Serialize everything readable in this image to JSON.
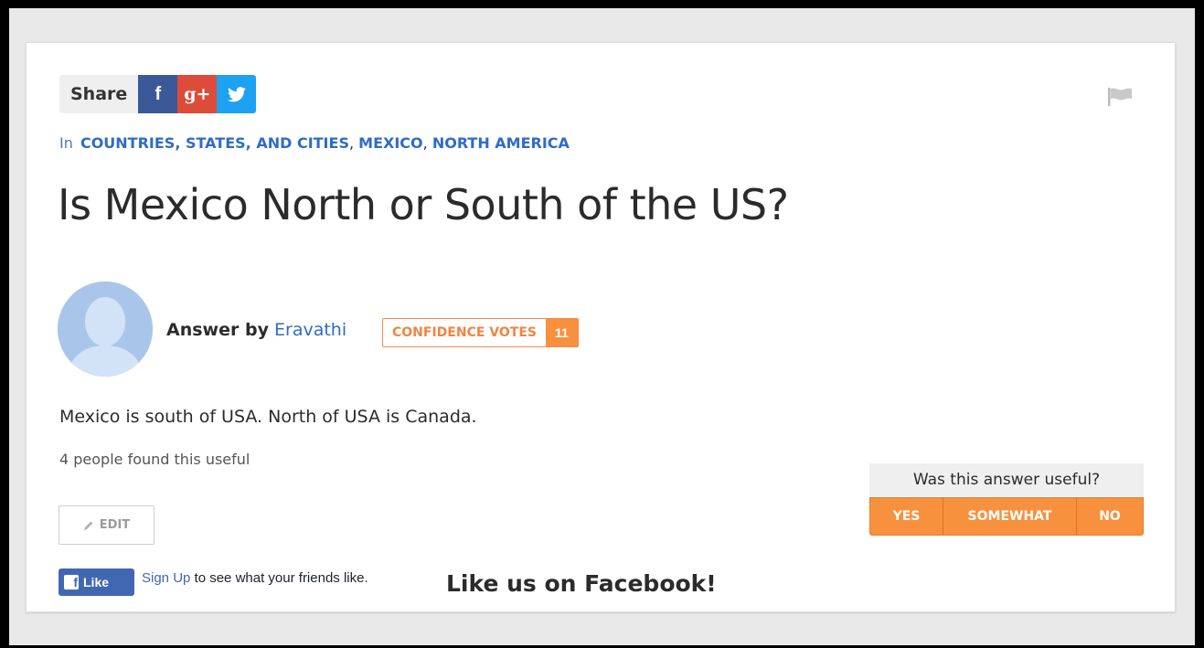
{
  "share": {
    "label": "Share",
    "facebook_glyph": "f",
    "googleplus_glyph": "g+",
    "twitter_icon": "twitter-bird-icon"
  },
  "breadcrumb": {
    "prefix": "In",
    "items": [
      "COUNTRIES, STATES, AND CITIES",
      "MEXICO",
      "NORTH AMERICA"
    ],
    "separator": ","
  },
  "question": {
    "title": "Is Mexico North or South of the US?"
  },
  "answer": {
    "by_label": "Answer by",
    "author": "Eravathi",
    "confidence_label": "CONFIDENCE VOTES",
    "confidence_count": "11",
    "text": "Mexico is south of USA. North of USA is Canada.",
    "useful_count_text": "4 people found this useful",
    "edit_label": "EDIT"
  },
  "feedback": {
    "question": "Was this answer useful?",
    "yes": "YES",
    "somewhat": "SOMEWHAT",
    "no": "NO"
  },
  "facebook": {
    "like_label": "Like",
    "signup_link": "Sign Up",
    "signup_text": " to see what your friends like.",
    "promo": "Like us on Facebook!"
  },
  "colors": {
    "accent_orange": "#f7913d",
    "link_blue": "#2e6cc7",
    "facebook_blue": "#3b5998",
    "googleplus_red": "#dd4b39",
    "twitter_blue": "#1da1f2"
  }
}
